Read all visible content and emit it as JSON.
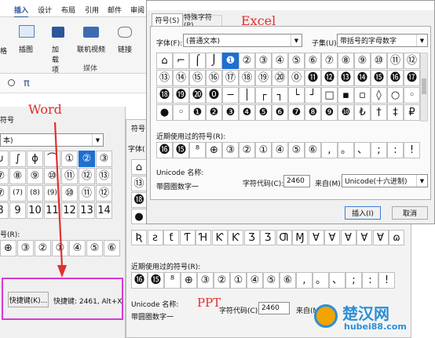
{
  "word": {
    "ribbon_tabs": [
      "插入",
      "设计",
      "布局",
      "引用",
      "邮件",
      "审阅"
    ],
    "groups": [
      "插图",
      "加载项",
      "联机视频",
      "链接"
    ],
    "media_label": "媒体",
    "pi": "π",
    "symbol_label": "符号",
    "font_value": "本)",
    "grid_rows": [
      [
        "∪",
        "∫",
        "ϕ",
        "⌒",
        "①",
        "②",
        "③"
      ],
      [
        "⑦",
        "⑧",
        "⑨",
        "⑩",
        "⑪",
        "⑫",
        "⑬"
      ],
      [
        "⑦",
        "(7)",
        "(8)",
        "(9)",
        "⑩",
        "⑪",
        "⑫"
      ],
      [
        "8",
        "9",
        "10",
        "11",
        "12",
        "13",
        "14"
      ]
    ],
    "recent_label": "号(R):",
    "recent": [
      "⊕",
      "③",
      "②",
      "①",
      "④",
      "⑤",
      "⑥"
    ],
    "shortcut_button": "快捷键(K)...",
    "shortcut_text": "快捷键: 2461, Alt+X"
  },
  "excel": {
    "title": "符号",
    "tabs": [
      "符号(S)",
      "特殊字符(P)"
    ],
    "font_label": "字体(F):",
    "font_value": "(普通文本)",
    "subset_label": "子集(U):",
    "subset_value": "带括号的字母数字",
    "grid_rows": [
      [
        "⌂",
        "⌐",
        "⌠",
        "⌡",
        "❶",
        "②",
        "③",
        "④",
        "⑤",
        "⑥",
        "⑦",
        "⑧",
        "⑨",
        "⑩",
        "⑪",
        "⑫"
      ],
      [
        "⑬",
        "⑭",
        "⑮",
        "⑯",
        "⑰",
        "⑱",
        "⑲",
        "⑳",
        "⓪",
        "⓫",
        "⓬",
        "⓭",
        "⓮",
        "⓯",
        "⓰",
        "⓱"
      ],
      [
        "⓲",
        "⓳",
        "⓴",
        "⓿",
        "─",
        "│",
        "┌",
        "┐",
        "└",
        "┘",
        "□",
        "▪",
        "▫",
        "◊",
        "○",
        "◦"
      ],
      [
        "●",
        "◦",
        "❶",
        "❷",
        "❸",
        "❹",
        "❺",
        "❻",
        "❼",
        "❽",
        "❾",
        "❿",
        "₺",
        "†",
        "‡",
        "₽"
      ]
    ],
    "recent_label": "近期使用过的符号(R):",
    "recent": [
      "⓰",
      "⓯",
      "⁸",
      "⊕",
      "③",
      "②",
      "①",
      "④",
      "⑤",
      "⑥",
      ",",
      "。",
      "、",
      ";",
      ":",
      "!"
    ],
    "unicode_label": "Unicode 名称:",
    "unicode_name": "带圆圈数字一",
    "code_label": "字符代码(C):",
    "code_value": "2460",
    "from_label": "来自(M):",
    "from_value": "Unicode(十六进制)",
    "insert_button": "插入(I)",
    "cancel_button": "取消",
    "annotation": "Excel"
  },
  "ppt": {
    "symbol_label": "符号",
    "font_label": "字体(",
    "grid_row": [
      "Ʀ",
      "ƨ",
      "ƭ",
      "Ƭ",
      "Ɦ",
      "Ƙ",
      "Ƙ",
      "Ʒ",
      "Ʒ",
      "Ƣ",
      "Ɱ",
      "Ɐ",
      "Ɐ",
      "Ɐ",
      "Ɐ",
      "Ɐ",
      "ɷ"
    ],
    "recent_label": "近期使用过的符号(R):",
    "recent": [
      "⓰",
      "⓯",
      "⁸",
      "⊕",
      "③",
      "②",
      "①",
      "④",
      "⑤",
      "⑥",
      ",",
      "。",
      "、",
      ";",
      ":",
      "!"
    ],
    "unicode_label": "Unicode 名称:",
    "unicode_name": "带圆圈数字一",
    "code_label": "字符代码(C):",
    "code_value": "2460",
    "from_label": "来自(M",
    "annotation": "PPT"
  },
  "annotations": {
    "word": "Word",
    "watermark_line1": "楚汉网",
    "watermark_line2": "hubei88.com"
  },
  "colors": {
    "annotation_red": "#e03030",
    "selection_blue": "#1e6fd0",
    "magenta_box": "#d63ad6",
    "word_blue": "#2b579a"
  }
}
